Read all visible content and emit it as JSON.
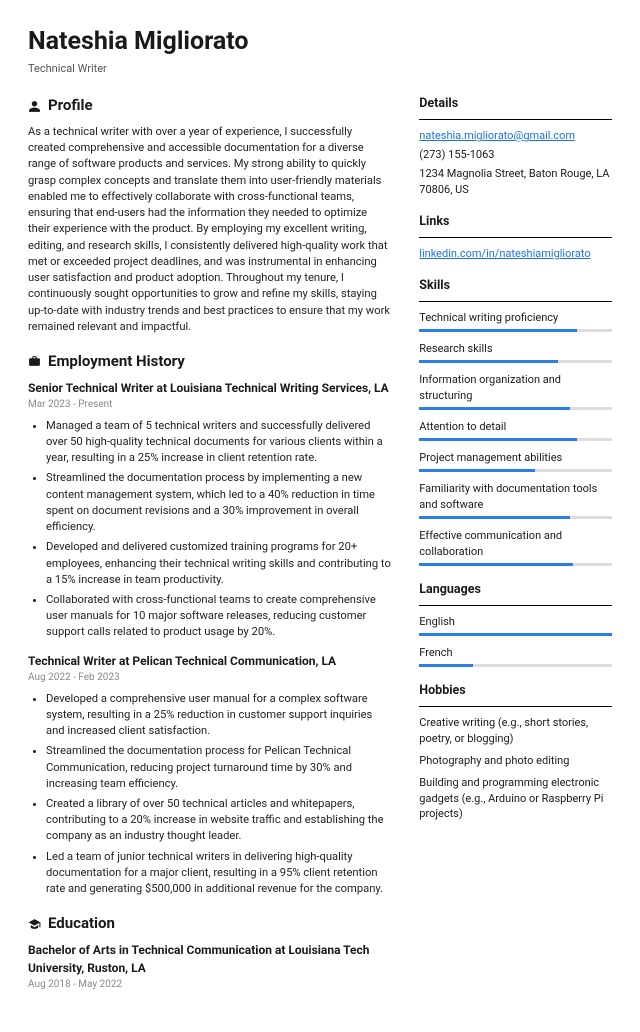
{
  "header": {
    "name": "Nateshia Migliorato",
    "role": "Technical Writer"
  },
  "profile": {
    "heading": "Profile",
    "text": "As a technical writer with over a year of experience, I successfully created comprehensive and accessible documentation for a diverse range of software products and services. My strong ability to quickly grasp complex concepts and translate them into user-friendly materials enabled me to effectively collaborate with cross-functional teams, ensuring that end-users had the information they needed to optimize their experience with the product. By employing my excellent writing, editing, and research skills, I consistently delivered high-quality work that met or exceeded project deadlines, and was instrumental in enhancing user satisfaction and product adoption. Throughout my tenure, I continuously sought opportunities to grow and refine my skills, staying up-to-date with industry trends and best practices to ensure that my work remained relevant and impactful."
  },
  "employment": {
    "heading": "Employment History",
    "jobs": [
      {
        "title": "Senior Technical Writer at Louisiana Technical Writing Services, LA",
        "dates": "Mar 2023 - Present",
        "bullets": [
          "Managed a team of 5 technical writers and successfully delivered over 50 high-quality technical documents for various clients within a year, resulting in a 25% increase in client retention rate.",
          "Streamlined the documentation process by implementing a new content management system, which led to a 40% reduction in time spent on document revisions and a 30% improvement in overall efficiency.",
          "Developed and delivered customized training programs for 20+ employees, enhancing their technical writing skills and contributing to a 15% increase in team productivity.",
          "Collaborated with cross-functional teams to create comprehensive user manuals for 10 major software releases, reducing customer support calls related to product usage by 20%."
        ]
      },
      {
        "title": "Technical Writer at Pelican Technical Communication, LA",
        "dates": "Aug 2022 - Feb 2023",
        "bullets": [
          "Developed a comprehensive user manual for a complex software system, resulting in a 25% reduction in customer support inquiries and increased client satisfaction.",
          "Streamlined the documentation process for Pelican Technical Communication, reducing project turnaround time by 30% and increasing team efficiency.",
          "Created a library of over 50 technical articles and whitepapers, contributing to a 20% increase in website traffic and establishing the company as an industry thought leader.",
          "Led a team of junior technical writers in delivering high-quality documentation for a major client, resulting in a 95% client retention rate and generating $500,000 in additional revenue for the company."
        ]
      }
    ]
  },
  "education": {
    "heading": "Education",
    "degree": "Bachelor of Arts in Technical Communication at Louisiana Tech University, Ruston, LA",
    "dates": "Aug 2018 - May 2022"
  },
  "details": {
    "heading": "Details",
    "email": "nateshia.migliorato@gmail.com",
    "phone": "(273) 155-1063",
    "address": "1234 Magnolia Street, Baton Rouge, LA 70806, US"
  },
  "links": {
    "heading": "Links",
    "items": [
      "linkedin.com/in/nateshiamigliorato"
    ]
  },
  "skills": {
    "heading": "Skills",
    "items": [
      {
        "name": "Technical writing proficiency",
        "pct": 82
      },
      {
        "name": "Research skills",
        "pct": 72
      },
      {
        "name": "Information organization and structuring",
        "pct": 78
      },
      {
        "name": "Attention to detail",
        "pct": 82
      },
      {
        "name": "Project management abilities",
        "pct": 60
      },
      {
        "name": "Familiarity with documentation tools and software",
        "pct": 78
      },
      {
        "name": "Effective communication and collaboration",
        "pct": 80
      }
    ]
  },
  "languages": {
    "heading": "Languages",
    "items": [
      {
        "name": "English",
        "pct": 100
      },
      {
        "name": "French",
        "pct": 28
      }
    ]
  },
  "hobbies": {
    "heading": "Hobbies",
    "items": [
      "Creative writing (e.g., short stories, poetry, or blogging)",
      "Photography and photo editing",
      "Building and programming electronic gadgets (e.g., Arduino or Raspberry Pi projects)"
    ]
  }
}
